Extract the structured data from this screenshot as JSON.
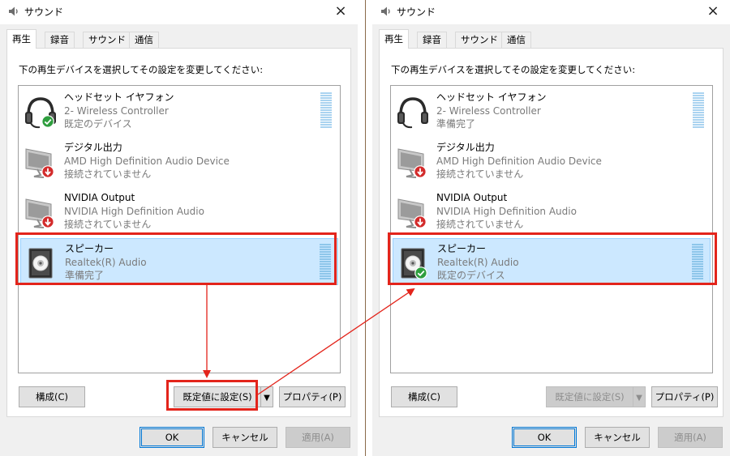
{
  "dialog_left": {
    "title": "サウンド",
    "tabs": [
      "再生",
      "録音",
      "サウンド",
      "通信"
    ],
    "instruction": "下の再生デバイスを選択してその設定を変更してください:",
    "devices": [
      {
        "name": "ヘッドセット イヤフォン",
        "desc": "2- Wireless Controller",
        "status": "既定のデバイス"
      },
      {
        "name": "デジタル出力",
        "desc": "AMD High Definition Audio Device",
        "status": "接続されていません"
      },
      {
        "name": "NVIDIA Output",
        "desc": "NVIDIA High Definition Audio",
        "status": "接続されていません"
      },
      {
        "name": "スピーカー",
        "desc": "Realtek(R) Audio",
        "status": "準備完了"
      }
    ],
    "buttons": {
      "configure": "構成(C)",
      "set_default": "既定値に設定(S)",
      "properties": "プロパティ(P)",
      "ok": "OK",
      "cancel": "キャンセル",
      "apply": "適用(A)"
    }
  },
  "dialog_right": {
    "title": "サウンド",
    "tabs": [
      "再生",
      "録音",
      "サウンド",
      "通信"
    ],
    "instruction": "下の再生デバイスを選択してその設定を変更してください:",
    "devices": [
      {
        "name": "ヘッドセット イヤフォン",
        "desc": "2- Wireless Controller",
        "status": "準備完了"
      },
      {
        "name": "デジタル出力",
        "desc": "AMD High Definition Audio Device",
        "status": "接続されていません"
      },
      {
        "name": "NVIDIA Output",
        "desc": "NVIDIA High Definition Audio",
        "status": "接続されていません"
      },
      {
        "name": "スピーカー",
        "desc": "Realtek(R) Audio",
        "status": "既定のデバイス"
      }
    ],
    "buttons": {
      "configure": "構成(C)",
      "set_default": "既定値に設定(S)",
      "properties": "プロパティ(P)",
      "ok": "OK",
      "cancel": "キャンセル",
      "apply": "適用(A)"
    }
  },
  "icons": {
    "app": "speaker-app-icon",
    "close": "×",
    "dropdown": "▼",
    "default_badge": "green-check-icon",
    "disconnected_badge": "red-down-arrow-icon"
  },
  "colors": {
    "accent": "#0078d7",
    "selection": "#cce8ff",
    "annotation": "#e3241b",
    "success": "#2e9e3e"
  }
}
